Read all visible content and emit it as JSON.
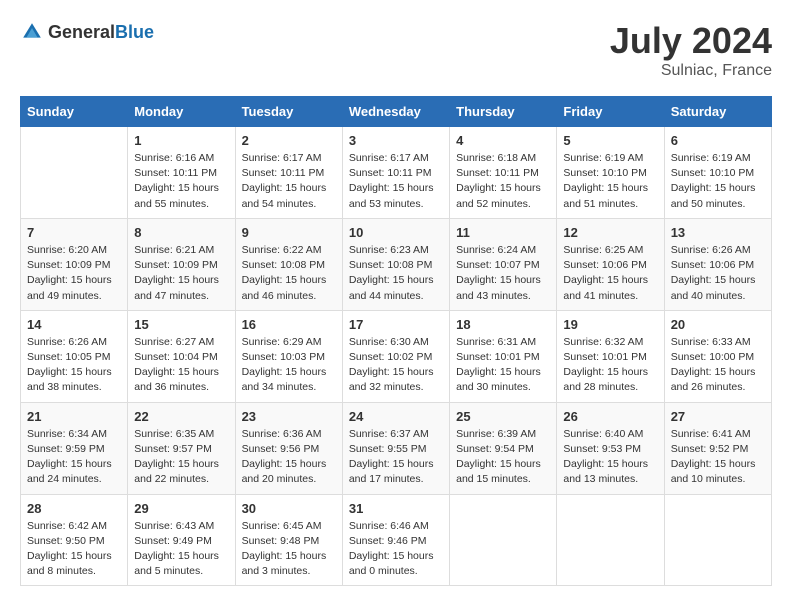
{
  "header": {
    "logo_general": "General",
    "logo_blue": "Blue",
    "month_year": "July 2024",
    "location": "Sulniac, France"
  },
  "weekdays": [
    "Sunday",
    "Monday",
    "Tuesday",
    "Wednesday",
    "Thursday",
    "Friday",
    "Saturday"
  ],
  "weeks": [
    [
      {
        "day": "",
        "info": ""
      },
      {
        "day": "1",
        "info": "Sunrise: 6:16 AM\nSunset: 10:11 PM\nDaylight: 15 hours\nand 55 minutes."
      },
      {
        "day": "2",
        "info": "Sunrise: 6:17 AM\nSunset: 10:11 PM\nDaylight: 15 hours\nand 54 minutes."
      },
      {
        "day": "3",
        "info": "Sunrise: 6:17 AM\nSunset: 10:11 PM\nDaylight: 15 hours\nand 53 minutes."
      },
      {
        "day": "4",
        "info": "Sunrise: 6:18 AM\nSunset: 10:11 PM\nDaylight: 15 hours\nand 52 minutes."
      },
      {
        "day": "5",
        "info": "Sunrise: 6:19 AM\nSunset: 10:10 PM\nDaylight: 15 hours\nand 51 minutes."
      },
      {
        "day": "6",
        "info": "Sunrise: 6:19 AM\nSunset: 10:10 PM\nDaylight: 15 hours\nand 50 minutes."
      }
    ],
    [
      {
        "day": "7",
        "info": "Sunrise: 6:20 AM\nSunset: 10:09 PM\nDaylight: 15 hours\nand 49 minutes."
      },
      {
        "day": "8",
        "info": "Sunrise: 6:21 AM\nSunset: 10:09 PM\nDaylight: 15 hours\nand 47 minutes."
      },
      {
        "day": "9",
        "info": "Sunrise: 6:22 AM\nSunset: 10:08 PM\nDaylight: 15 hours\nand 46 minutes."
      },
      {
        "day": "10",
        "info": "Sunrise: 6:23 AM\nSunset: 10:08 PM\nDaylight: 15 hours\nand 44 minutes."
      },
      {
        "day": "11",
        "info": "Sunrise: 6:24 AM\nSunset: 10:07 PM\nDaylight: 15 hours\nand 43 minutes."
      },
      {
        "day": "12",
        "info": "Sunrise: 6:25 AM\nSunset: 10:06 PM\nDaylight: 15 hours\nand 41 minutes."
      },
      {
        "day": "13",
        "info": "Sunrise: 6:26 AM\nSunset: 10:06 PM\nDaylight: 15 hours\nand 40 minutes."
      }
    ],
    [
      {
        "day": "14",
        "info": "Sunrise: 6:26 AM\nSunset: 10:05 PM\nDaylight: 15 hours\nand 38 minutes."
      },
      {
        "day": "15",
        "info": "Sunrise: 6:27 AM\nSunset: 10:04 PM\nDaylight: 15 hours\nand 36 minutes."
      },
      {
        "day": "16",
        "info": "Sunrise: 6:29 AM\nSunset: 10:03 PM\nDaylight: 15 hours\nand 34 minutes."
      },
      {
        "day": "17",
        "info": "Sunrise: 6:30 AM\nSunset: 10:02 PM\nDaylight: 15 hours\nand 32 minutes."
      },
      {
        "day": "18",
        "info": "Sunrise: 6:31 AM\nSunset: 10:01 PM\nDaylight: 15 hours\nand 30 minutes."
      },
      {
        "day": "19",
        "info": "Sunrise: 6:32 AM\nSunset: 10:01 PM\nDaylight: 15 hours\nand 28 minutes."
      },
      {
        "day": "20",
        "info": "Sunrise: 6:33 AM\nSunset: 10:00 PM\nDaylight: 15 hours\nand 26 minutes."
      }
    ],
    [
      {
        "day": "21",
        "info": "Sunrise: 6:34 AM\nSunset: 9:59 PM\nDaylight: 15 hours\nand 24 minutes."
      },
      {
        "day": "22",
        "info": "Sunrise: 6:35 AM\nSunset: 9:57 PM\nDaylight: 15 hours\nand 22 minutes."
      },
      {
        "day": "23",
        "info": "Sunrise: 6:36 AM\nSunset: 9:56 PM\nDaylight: 15 hours\nand 20 minutes."
      },
      {
        "day": "24",
        "info": "Sunrise: 6:37 AM\nSunset: 9:55 PM\nDaylight: 15 hours\nand 17 minutes."
      },
      {
        "day": "25",
        "info": "Sunrise: 6:39 AM\nSunset: 9:54 PM\nDaylight: 15 hours\nand 15 minutes."
      },
      {
        "day": "26",
        "info": "Sunrise: 6:40 AM\nSunset: 9:53 PM\nDaylight: 15 hours\nand 13 minutes."
      },
      {
        "day": "27",
        "info": "Sunrise: 6:41 AM\nSunset: 9:52 PM\nDaylight: 15 hours\nand 10 minutes."
      }
    ],
    [
      {
        "day": "28",
        "info": "Sunrise: 6:42 AM\nSunset: 9:50 PM\nDaylight: 15 hours\nand 8 minutes."
      },
      {
        "day": "29",
        "info": "Sunrise: 6:43 AM\nSunset: 9:49 PM\nDaylight: 15 hours\nand 5 minutes."
      },
      {
        "day": "30",
        "info": "Sunrise: 6:45 AM\nSunset: 9:48 PM\nDaylight: 15 hours\nand 3 minutes."
      },
      {
        "day": "31",
        "info": "Sunrise: 6:46 AM\nSunset: 9:46 PM\nDaylight: 15 hours\nand 0 minutes."
      },
      {
        "day": "",
        "info": ""
      },
      {
        "day": "",
        "info": ""
      },
      {
        "day": "",
        "info": ""
      }
    ]
  ]
}
